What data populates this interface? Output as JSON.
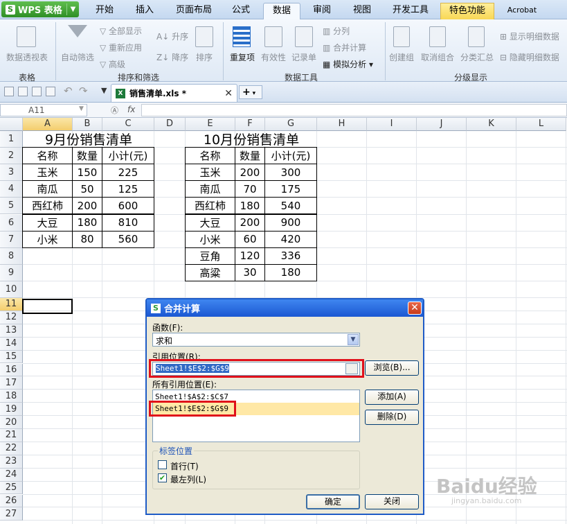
{
  "app": {
    "name": "WPS 表格",
    "logo": "S"
  },
  "tabs": [
    "开始",
    "插入",
    "页面布局",
    "公式",
    "数据",
    "审阅",
    "视图",
    "开发工具",
    "特色功能",
    "Acrobat"
  ],
  "ribbon": {
    "pivot": "数据透视表",
    "autofilter": "自动筛选",
    "showall": "全部显示",
    "reapply": "重新应用",
    "advanced": "高级",
    "asc": "升序",
    "desc": "降序",
    "sort": "排序",
    "dup": "重复项",
    "valid": "有效性",
    "record": "记录单",
    "split": "分列",
    "consolidate": "合并计算",
    "whatif": "模拟分析",
    "group": "创建组",
    "ungroup": "取消组合",
    "subtotal": "分类汇总",
    "showdetail": "显示明细数据",
    "hidedetail": "隐藏明细数据",
    "groups": [
      "表格",
      "排序和筛选",
      "数据工具",
      "分级显示"
    ]
  },
  "document": {
    "filename": "销售清单.xls *",
    "cell_ref": "A11",
    "fx": "fx"
  },
  "columns": [
    "A",
    "B",
    "C",
    "D",
    "E",
    "F",
    "G",
    "H",
    "I",
    "J",
    "K",
    "L"
  ],
  "rows": [
    "1",
    "2",
    "3",
    "4",
    "5",
    "6",
    "7",
    "8",
    "9",
    "10",
    "11",
    "12",
    "13",
    "14",
    "15",
    "16",
    "17",
    "18",
    "19",
    "20",
    "21",
    "22",
    "23",
    "24",
    "25",
    "26",
    "27"
  ],
  "table1": {
    "title": "9月份销售清单",
    "headers": [
      "名称",
      "数量",
      "小计(元)"
    ],
    "rows": [
      [
        "玉米",
        "150",
        "225"
      ],
      [
        "南瓜",
        "50",
        "125"
      ],
      [
        "西红柿",
        "200",
        "600"
      ],
      [
        "大豆",
        "180",
        "810"
      ],
      [
        "小米",
        "80",
        "560"
      ]
    ]
  },
  "table2": {
    "title": "10月份销售清单",
    "headers": [
      "名称",
      "数量",
      "小计(元)"
    ],
    "rows": [
      [
        "玉米",
        "200",
        "300"
      ],
      [
        "南瓜",
        "70",
        "175"
      ],
      [
        "西红柿",
        "180",
        "540"
      ],
      [
        "大豆",
        "200",
        "900"
      ],
      [
        "小米",
        "60",
        "420"
      ],
      [
        "豆角",
        "120",
        "336"
      ],
      [
        "高粱",
        "30",
        "180"
      ]
    ]
  },
  "dialog": {
    "title": "合并计算",
    "func_label": "函数(F):",
    "func_value": "求和",
    "ref_label": "引用位置(R):",
    "ref_value": "Sheet1!$E$2:$G$9",
    "browse": "浏览(B)...",
    "all_label": "所有引用位置(E):",
    "all_refs": [
      "Sheet1!$A$2:$C$7",
      "Sheet1!$E$2:$G$9"
    ],
    "add": "添加(A)",
    "delete": "删除(D)",
    "label_group": "标签位置",
    "first_row": "首行(T)",
    "left_col": "最左列(L)",
    "ok": "确定",
    "close": "关闭"
  },
  "watermark": {
    "main": "Baidu经验",
    "sub": "jingyan.baidu.com"
  }
}
